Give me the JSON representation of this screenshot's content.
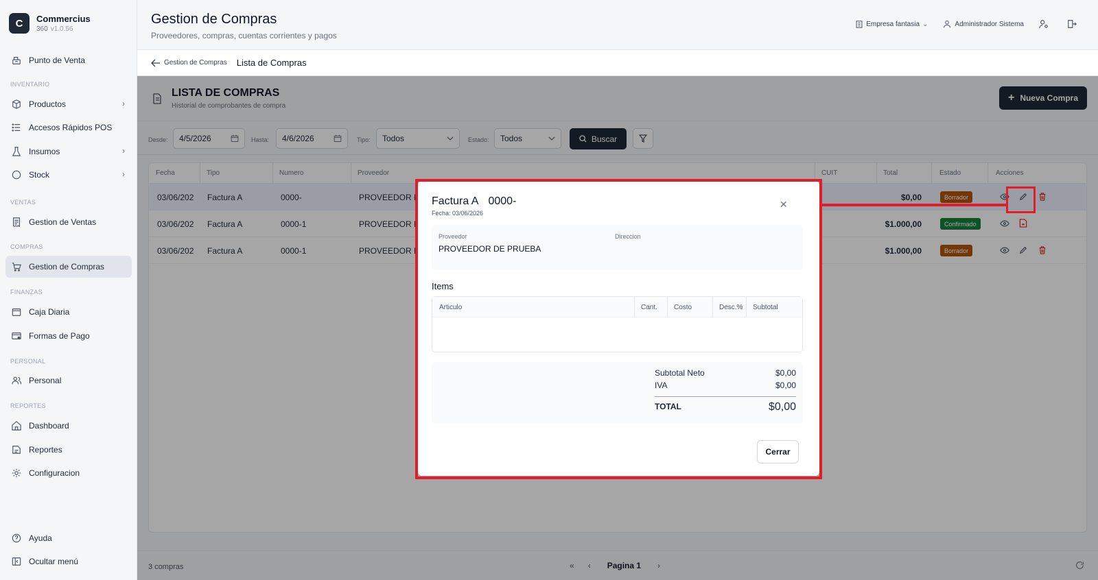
{
  "brand": {
    "logo_letter": "C",
    "name": "Commercius",
    "sub": "360",
    "version": "v1.0.56"
  },
  "sidebar": {
    "sections": {
      "inventario": "INVENTARIO",
      "ventas": "VENTAS",
      "compras": "COMPRAS",
      "finanzas": "FINANZAS",
      "personal": "PERSONAL",
      "reportes": "REPORTES"
    },
    "items": {
      "punto_venta": "Punto de Venta",
      "productos": "Productos",
      "accesos": "Accesos Rápidos POS",
      "insumos": "Insumos",
      "stock": "Stock",
      "gestion_ventas": "Gestion de Ventas",
      "gestion_compras": "Gestion de Compras",
      "caja": "Caja Diaria",
      "formas_pago": "Formas de Pago",
      "personal": "Personal",
      "dashboard": "Dashboard",
      "reportes": "Reportes",
      "configuracion": "Configuracion",
      "ayuda": "Ayuda",
      "ocultar": "Ocultar menú"
    }
  },
  "header": {
    "title": "Gestion de Compras",
    "subtitle": "Proveedores, compras, cuentas corrientes y pagos",
    "company": "Empresa fantasia",
    "user": "Administrador Sistema"
  },
  "breadcrumb": {
    "back": "Gestion de Compras",
    "current": "Lista de Compras"
  },
  "list": {
    "title": "LISTA DE COMPRAS",
    "subtitle": "Historial de comprobantes de compra",
    "new_button": "Nueva Compra"
  },
  "filters": {
    "desde_label": "Desde:",
    "desde_value": "4/5/2026",
    "hasta_label": "Hasta:",
    "hasta_value": "4/6/2026",
    "tipo_label": "Tipo:",
    "tipo_value": "Todos",
    "estado_label": "Estado:",
    "estado_value": "Todos",
    "search_button": "Buscar"
  },
  "table": {
    "headers": {
      "fecha": "Fecha",
      "tipo": "Tipo",
      "numero": "Numero",
      "proveedor": "Proveedor",
      "cuit": "CUIT",
      "total": "Total",
      "estado": "Estado",
      "acciones": "Acciones"
    },
    "rows": [
      {
        "fecha": "03/06/202",
        "tipo": "Factura A",
        "numero": "0000-",
        "proveedor": "PROVEEDOR D",
        "total": "$0,00",
        "estado": "Borrador"
      },
      {
        "fecha": "03/06/202",
        "tipo": "Factura A",
        "numero": "0000-1",
        "proveedor": "PROVEEDOR D",
        "total": "$1.000,00",
        "estado": "Confirmado"
      },
      {
        "fecha": "03/06/202",
        "tipo": "Factura A",
        "numero": "0000-1",
        "proveedor": "PROVEEDOR D",
        "total": "$1.000,00",
        "estado": "Borrador"
      }
    ]
  },
  "footer": {
    "count": "3 compras",
    "page": "Pagina 1"
  },
  "modal": {
    "tipo": "Factura A",
    "numero": "0000-",
    "fecha": "Fecha: 03/06/2026",
    "proveedor_label": "Proveedor",
    "proveedor_value": "PROVEEDOR DE PRUEBA",
    "direccion_label": "Direccion",
    "items_title": "Items",
    "items_headers": {
      "articulo": "Articulo",
      "cant": "Cant.",
      "costo": "Costo",
      "desc": "Desc.%",
      "subtotal": "Subtotal"
    },
    "subtotal_neto_label": "Subtotal Neto",
    "subtotal_neto_value": "$0,00",
    "iva_label": "IVA",
    "iva_value": "$0,00",
    "total_label": "TOTAL",
    "total_value": "$0,00",
    "close_button": "Cerrar"
  },
  "colors": {
    "primary": "#1f2937",
    "borrador": "#b45309",
    "confirmado": "#15803d",
    "highlight": "#e11d2a",
    "delete": "#dc2626"
  }
}
